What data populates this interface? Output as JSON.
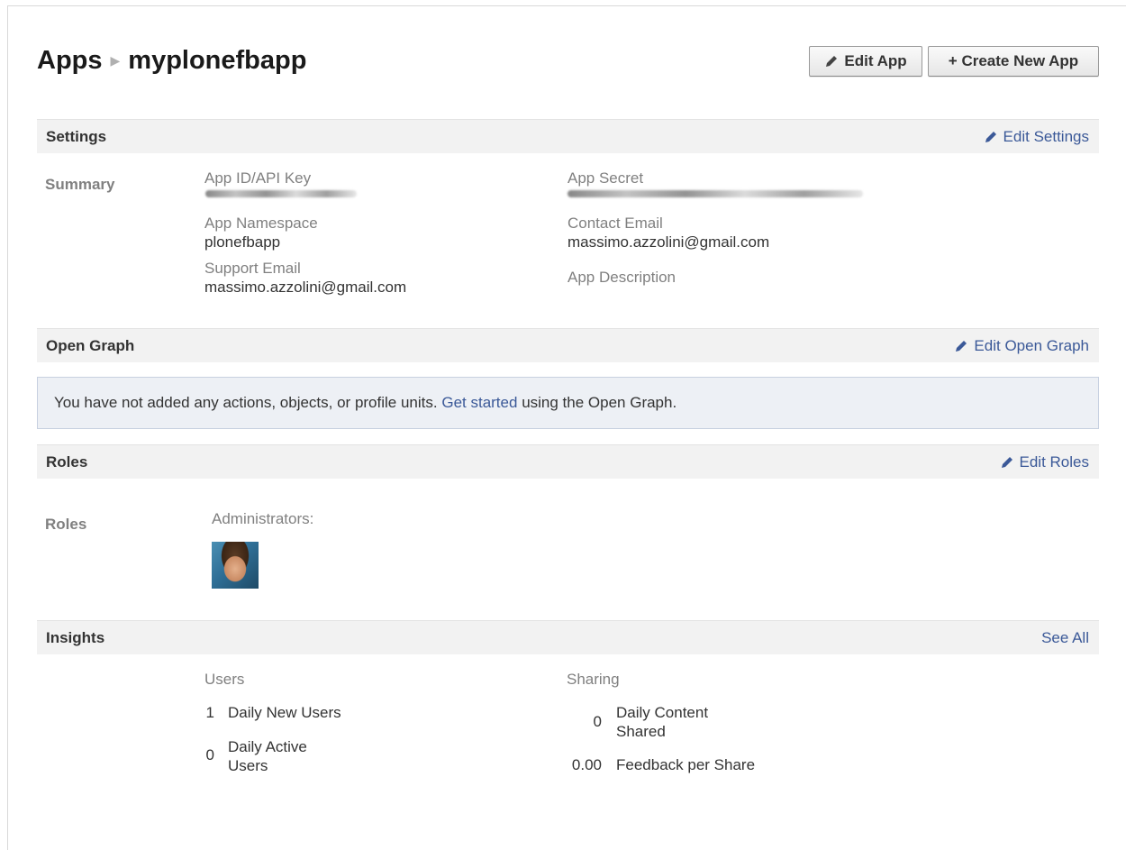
{
  "breadcrumb": {
    "root": "Apps",
    "current": "myplonefbapp"
  },
  "header_buttons": {
    "edit_app": "Edit App",
    "create_new_app": "+ Create New App"
  },
  "settings": {
    "title": "Settings",
    "edit_link": "Edit Settings",
    "summary_label": "Summary",
    "app_id_label": "App ID/API Key",
    "app_secret_label": "App Secret",
    "namespace_label": "App Namespace",
    "namespace_value": "plonefbapp",
    "contact_email_label": "Contact Email",
    "contact_email_value": "massimo.azzolini@gmail.com",
    "support_email_label": "Support Email",
    "support_email_value": "massimo.azzolini@gmail.com",
    "description_label": "App Description"
  },
  "open_graph": {
    "title": "Open Graph",
    "edit_link": "Edit Open Graph",
    "notice_before": "You have not added any actions, objects, or profile units.",
    "notice_link": "Get started",
    "notice_after": "using the Open Graph."
  },
  "roles": {
    "title": "Roles",
    "edit_link": "Edit Roles",
    "row_label": "Roles",
    "administrators_label": "Administrators:"
  },
  "insights": {
    "title": "Insights",
    "see_all": "See All",
    "users_heading": "Users",
    "sharing_heading": "Sharing",
    "daily_new_users_value": "1",
    "daily_new_users_label": "Daily New Users",
    "daily_active_users_value": "0",
    "daily_active_users_line1": "Daily Active",
    "daily_active_users_line2": "Users",
    "daily_content_shared_value": "0",
    "daily_content_shared_line1": "Daily Content",
    "daily_content_shared_line2": "Shared",
    "feedback_per_share_value": "0.00",
    "feedback_per_share_label": "Feedback per Share"
  },
  "colors": {
    "link": "#3b5998",
    "section_bg": "#f2f2f2",
    "notice_bg": "#edf0f5"
  }
}
